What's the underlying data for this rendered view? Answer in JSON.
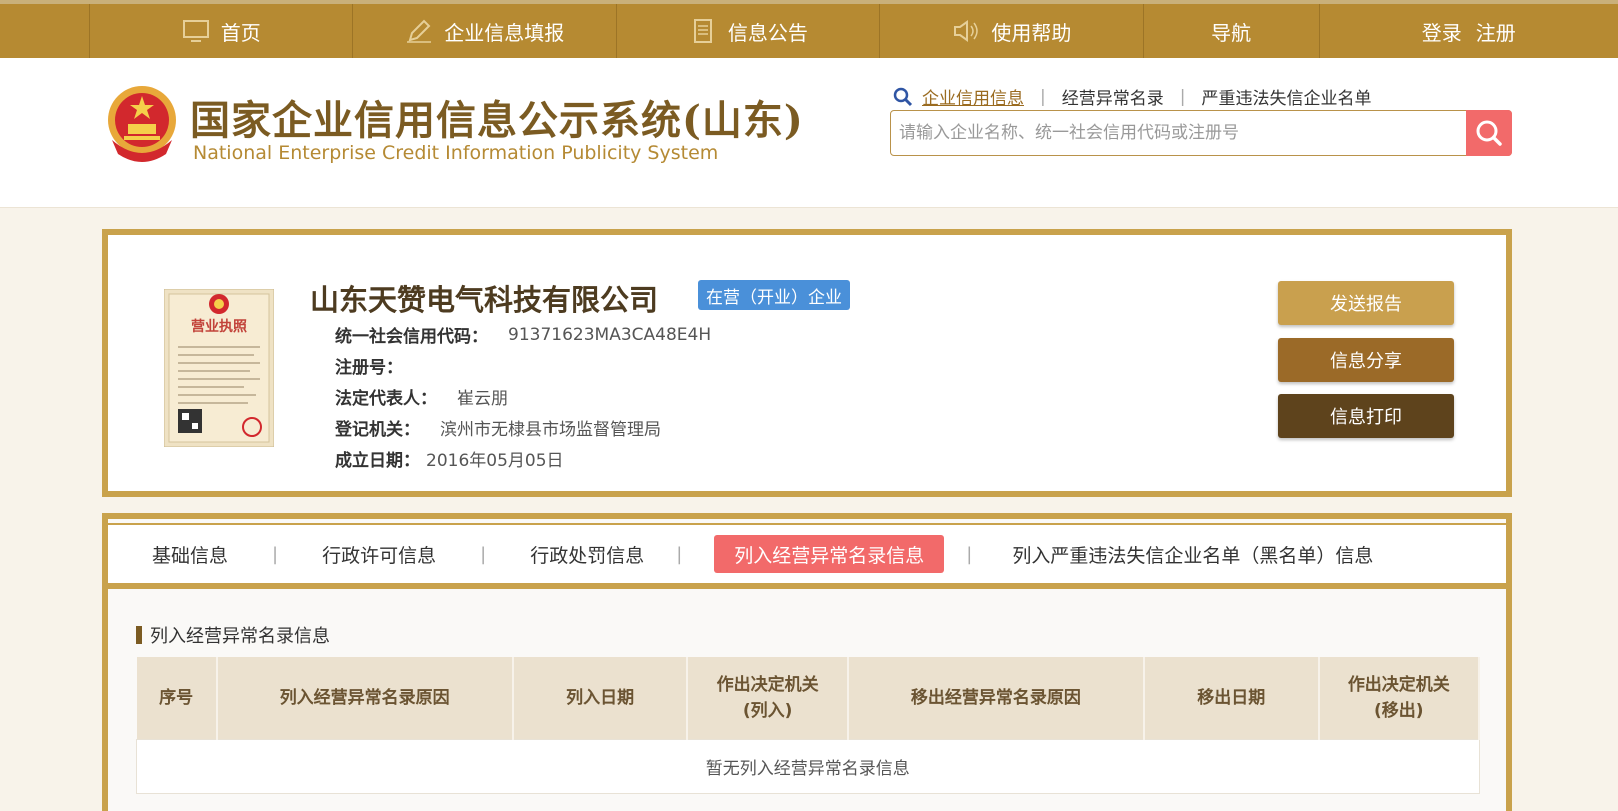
{
  "topnav": {
    "items": [
      {
        "label": "首页",
        "icon": "monitor-icon"
      },
      {
        "label": "企业信息填报",
        "icon": "pen-icon"
      },
      {
        "label": "信息公告",
        "icon": "document-icon"
      },
      {
        "label": "使用帮助",
        "icon": "speaker-icon"
      },
      {
        "label": "导航",
        "icon": ""
      }
    ],
    "login_label": "登录",
    "register_label": "注册"
  },
  "header": {
    "title": "国家企业信用信息公示系统(山东)",
    "subtitle": "National Enterprise Credit Information Publicity System",
    "search_links": [
      "企业信用信息",
      "经营异常名录",
      "严重违法失信企业名单"
    ],
    "search_placeholder": "请输入企业名称、统一社会信用代码或注册号"
  },
  "company": {
    "name": "山东天赞电气科技有限公司",
    "status": "在营（开业）企业",
    "credit_code_label": "统一社会信用代码：",
    "credit_code": "91371623MA3CA48E4H",
    "reg_no_label": "注册号：",
    "reg_no": "",
    "legal_rep_label": "法定代表人：",
    "legal_rep": "崔云朋",
    "authority_label": "登记机关：",
    "authority": "滨州市无棣县市场监督管理局",
    "founded_label": "成立日期：",
    "founded": "2016年05月05日",
    "license_title": "营业执照",
    "buttons": {
      "send": "发送报告",
      "share": "信息分享",
      "print": "信息打印"
    }
  },
  "tabs": {
    "items": [
      "基础信息",
      "行政许可信息",
      "行政处罚信息",
      "列入经营异常名录信息",
      "列入严重违法失信企业名单（黑名单）信息"
    ],
    "active_index": 3
  },
  "section": {
    "title": "列入经营异常名录信息",
    "columns": [
      "序号",
      "列入经营异常名录原因",
      "列入日期",
      "作出决定机关\n(列入)",
      "移出经营异常名录原因",
      "移出日期",
      "作出决定机关\n(移出)"
    ],
    "empty_text": "暂无列入经营异常名录信息"
  },
  "colors": {
    "nav_bg": "#b68a32",
    "border_gold": "#c9a24c",
    "accent_red": "#f26a6a",
    "badge_blue": "#4a90d9"
  }
}
